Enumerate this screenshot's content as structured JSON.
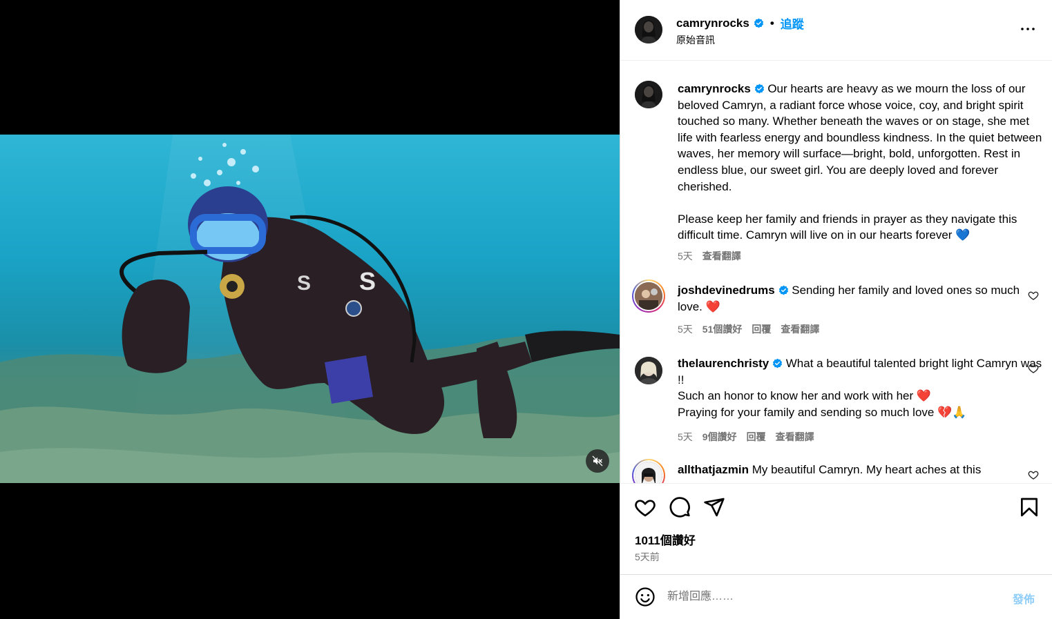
{
  "header": {
    "username": "camrynrocks",
    "separator": "•",
    "follow_label": "追蹤",
    "audio_label": "原始音訊"
  },
  "caption": {
    "username": "camrynrocks",
    "paragraph1": "Our hearts are heavy as we mourn the loss of our beloved Camryn, a radiant force whose voice, coy, and bright spirit touched so many. Whether beneath the waves or on stage, she met life with fearless energy and boundless kindness. In the quiet between waves, her memory will surface—bright, bold, unforgotten. Rest in endless blue, our sweet girl. You are deeply loved and forever cherished.",
    "paragraph2": "Please keep her family and friends in prayer as they navigate this difficult time. Camryn will live on in our hearts forever 💙",
    "age": "5天",
    "see_translation": "查看翻譯"
  },
  "comments": [
    {
      "username": "joshdevinedrums",
      "text": "Sending her family and loved ones so much love. ❤️",
      "age": "5天",
      "likes": "51個讚好",
      "reply": "回覆",
      "see_translation": "查看翻譯"
    },
    {
      "username": "thelaurenchristy",
      "line1": "What a beautiful talented bright light Camryn was !!",
      "line2": "Such an honor to know her and work with her ❤️",
      "line3": "Praying for your family and sending so much love 💔🙏",
      "age": "5天",
      "likes": "9個讚好",
      "reply": "回覆",
      "see_translation": "查看翻譯"
    },
    {
      "username": "allthatjazmin",
      "text": "My beautiful Camryn. My heart aches at this"
    }
  ],
  "post": {
    "likes": "1011個讚好",
    "time": "5天前"
  },
  "comment_box": {
    "placeholder": "新增回應……",
    "post_label": "發佈"
  },
  "colors": {
    "accent": "#0095f6",
    "post_disabled": "#8fcdf9",
    "muted": "#737373"
  }
}
